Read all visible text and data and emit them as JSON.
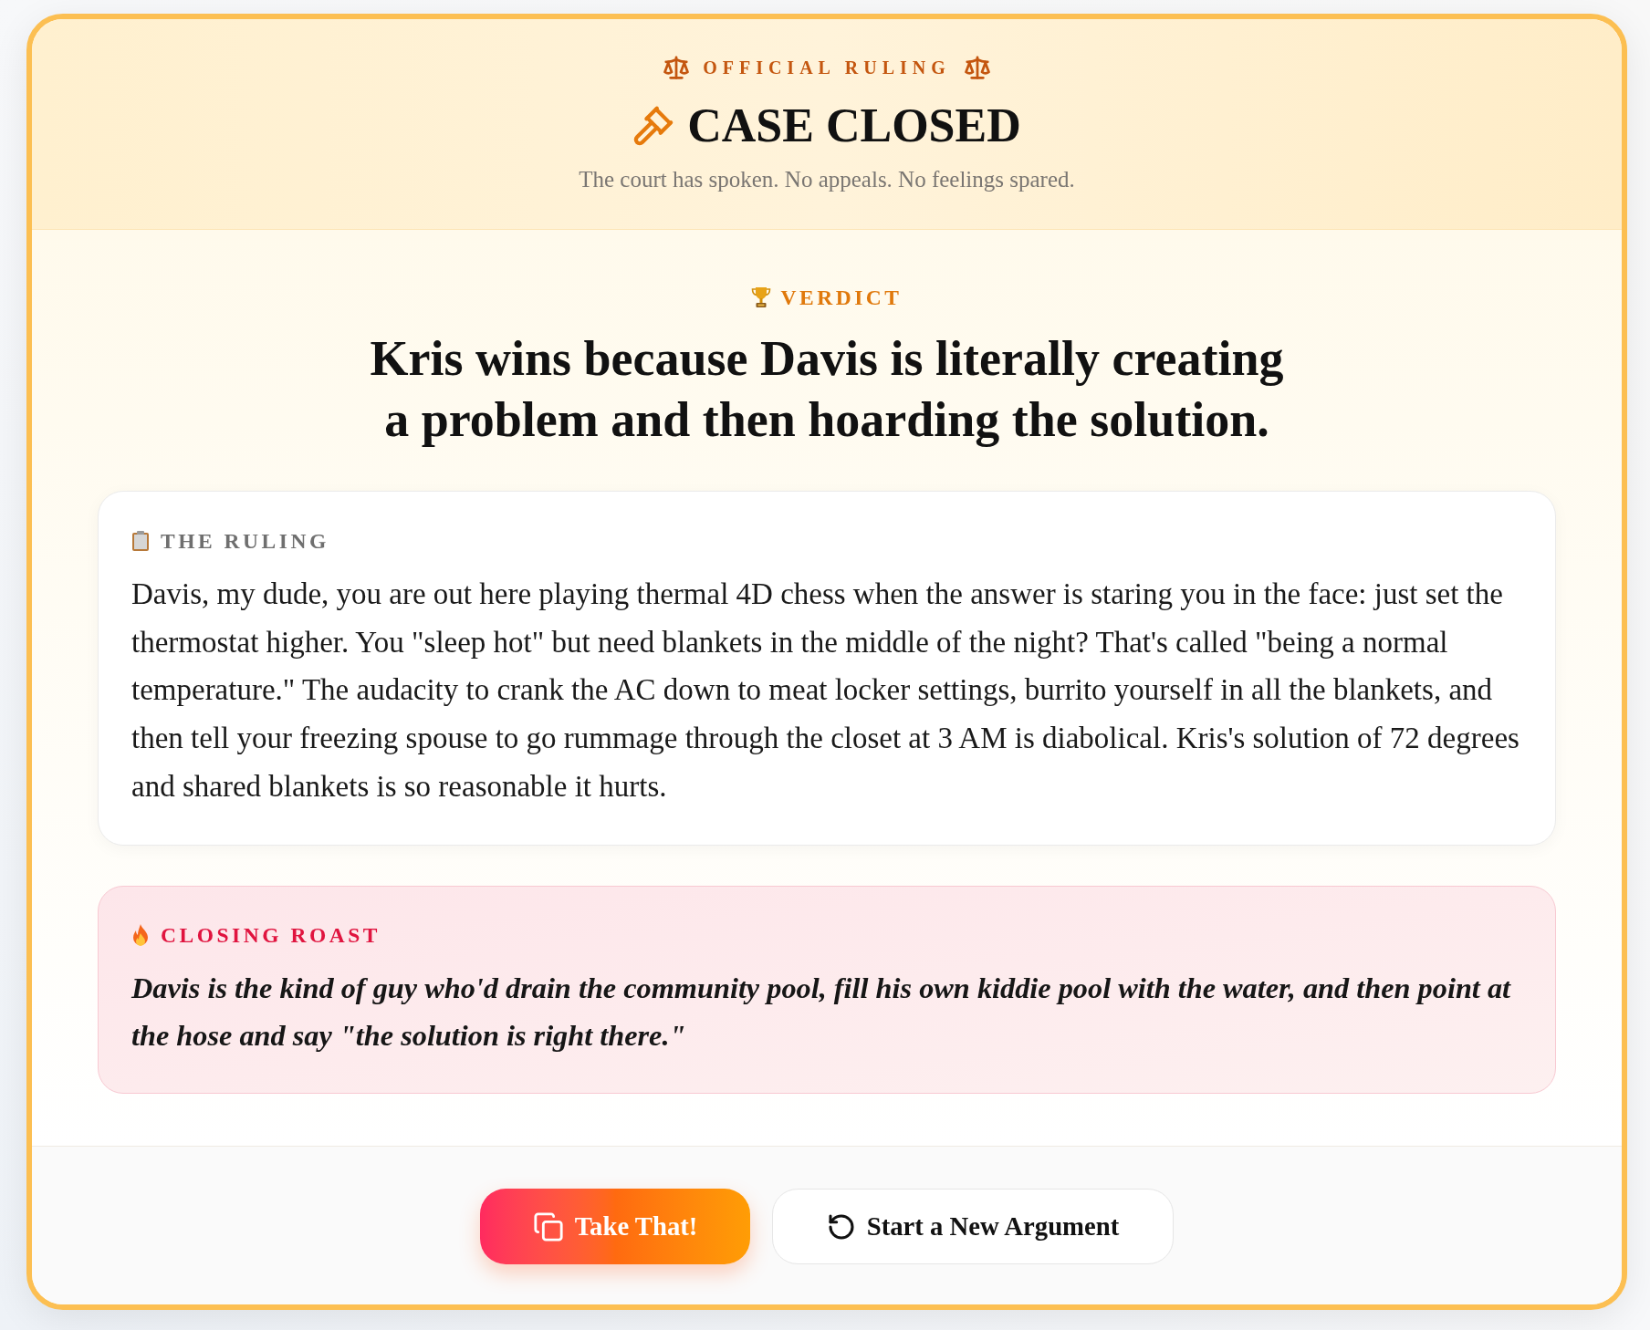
{
  "header": {
    "eyebrow": "OFFICIAL RULING",
    "title": "CASE CLOSED",
    "subtitle": "The court has spoken. No appeals. No feelings spared."
  },
  "verdict": {
    "label": "VERDICT",
    "text": "Kris wins because Davis is literally creating a problem and then hoarding the solution."
  },
  "sections": [
    {
      "kind": "ruling",
      "label": "THE RULING",
      "text": "Davis, my dude, you are out here playing thermal 4D chess when the answer is staring you in the face: just set the thermostat higher. You \"sleep hot\" but need blankets in the middle of the night? That's called \"being a normal temperature.\" The audacity to crank the AC down to meat locker settings, burrito yourself in all the blankets, and then tell your freezing spouse to go rummage through the closet at 3 AM is diabolical. Kris's solution of 72 degrees and shared blankets is so reasonable it hurts."
    },
    {
      "kind": "roast",
      "label": "CLOSING ROAST",
      "text": "Davis is the kind of guy who'd drain the community pool, fill his own kiddie pool with the water, and then point at the hose and say \"the solution is right there.\""
    }
  ],
  "buttons": [
    {
      "kind": "primary",
      "label": "Take That!"
    },
    {
      "kind": "secondary",
      "label": "Start a New Argument"
    }
  ]
}
